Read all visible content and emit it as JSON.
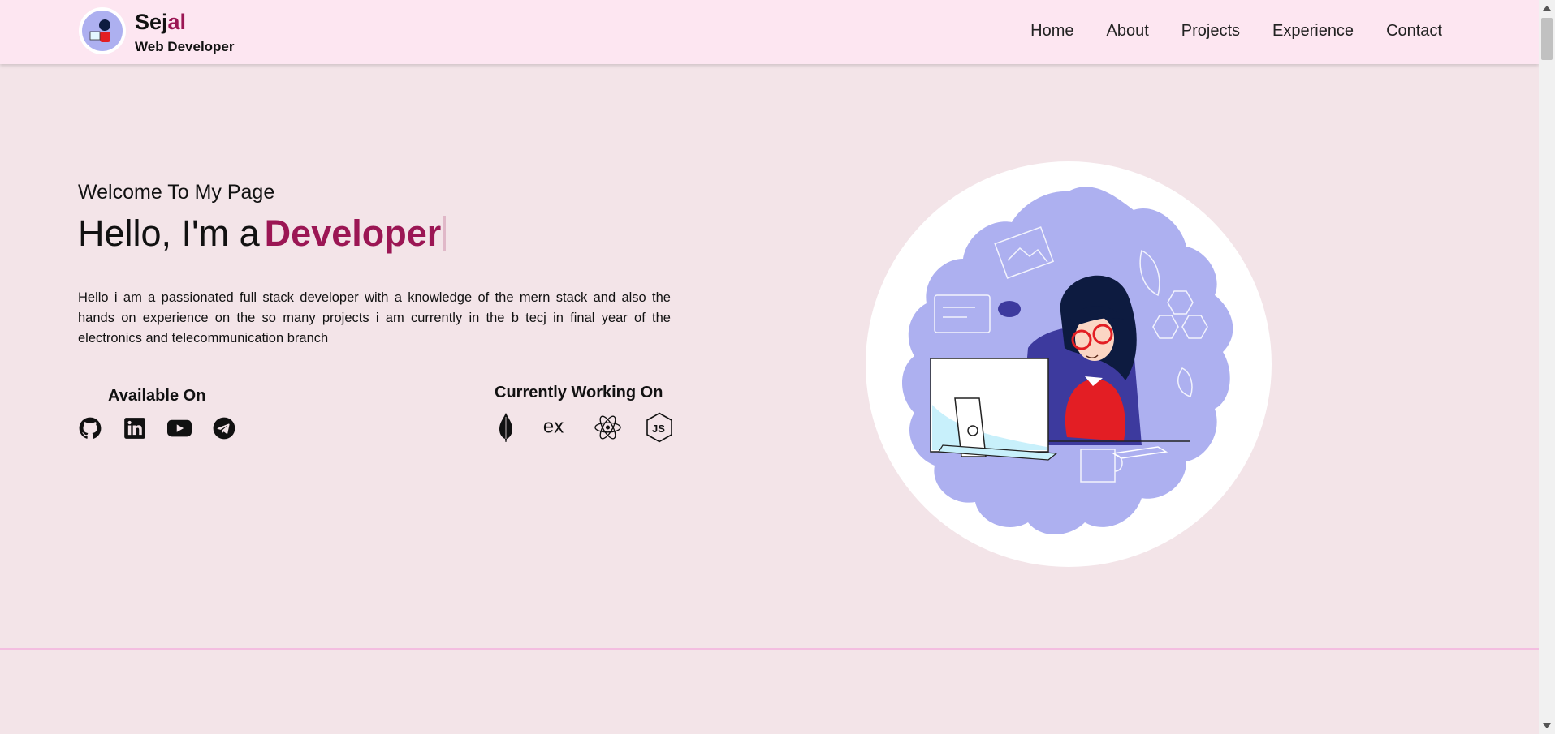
{
  "header": {
    "brand_name_part1": "Sej",
    "brand_name_part2": "al",
    "brand_role": "Web Developer",
    "nav": [
      "Home",
      "About",
      "Projects",
      "Experience",
      "Contact"
    ]
  },
  "hero": {
    "welcome": "Welcome To My Page",
    "greeting": "Hello, I'm a",
    "role": "Developer",
    "bio": "Hello i am a passionated full stack developer with a knowledge of the mern stack and also the hands on experience on the so many projects i am currently in the b tecj in final year of the electronics and telecommunication branch"
  },
  "available": {
    "title": "Available On",
    "icons": [
      "github-icon",
      "linkedin-icon",
      "youtube-icon",
      "telegram-icon"
    ]
  },
  "working": {
    "title": "Currently Working On",
    "icons": [
      "mongodb-icon",
      "express-icon",
      "react-icon",
      "nodejs-icon"
    ]
  },
  "colors": {
    "accent": "#9b1654",
    "header_bg": "#fde6f1",
    "page_bg": "#f3e4e8",
    "divider": "#f3bde0",
    "illustration_blob": "#adb0f0"
  }
}
